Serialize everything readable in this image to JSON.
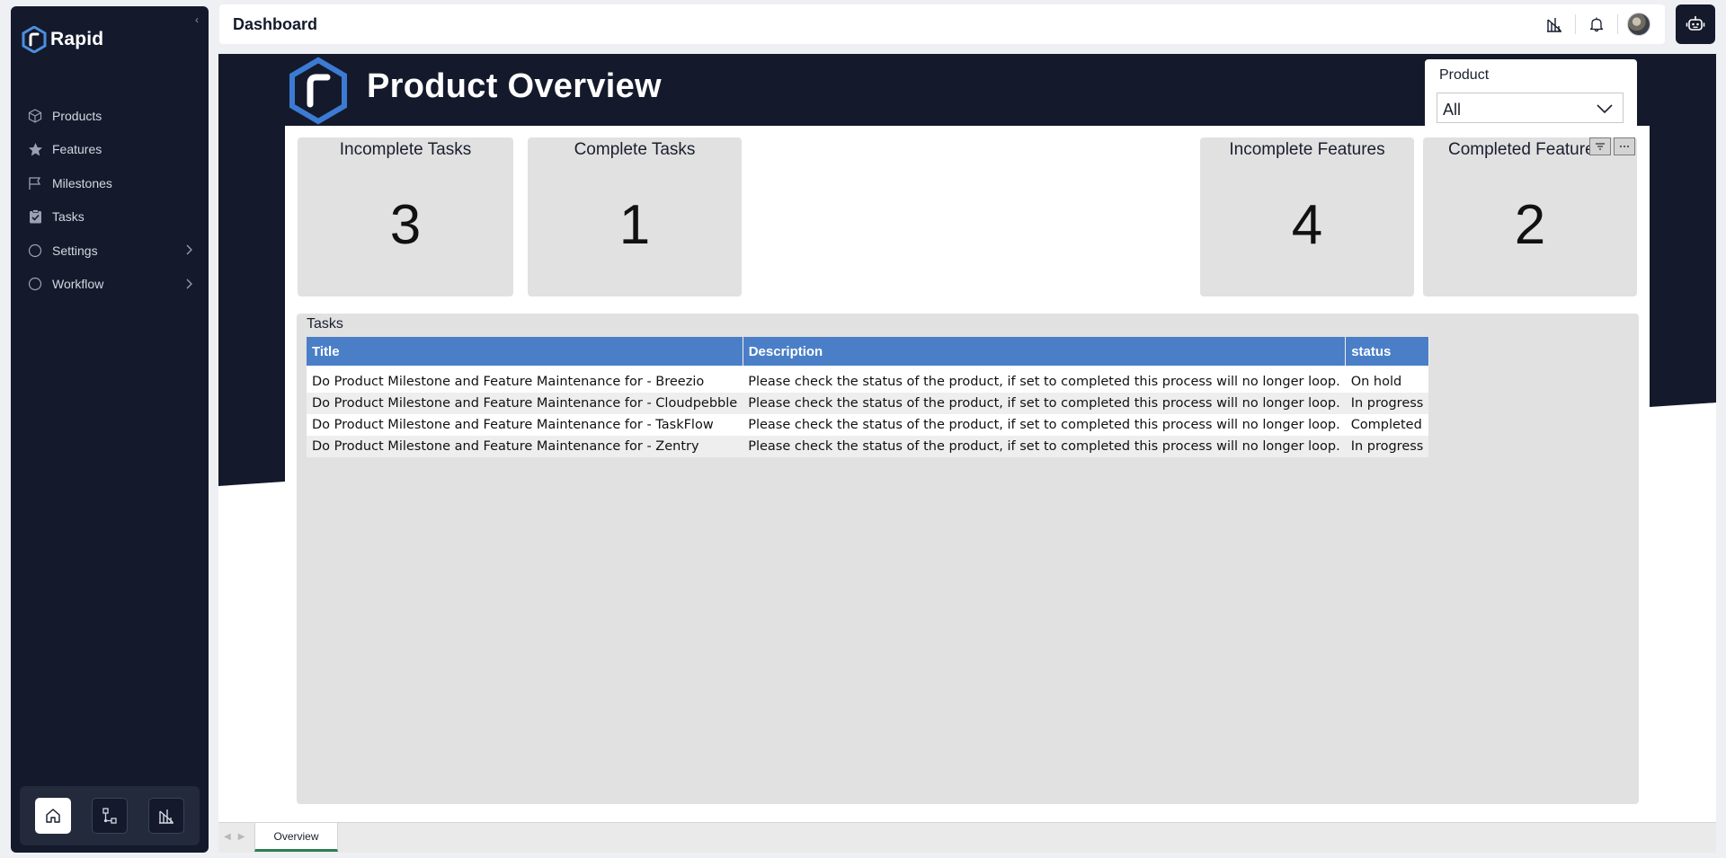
{
  "sidebar": {
    "brand": "Rapid",
    "items": [
      {
        "label": "Products",
        "icon": "box-icon"
      },
      {
        "label": "Features",
        "icon": "star-icon"
      },
      {
        "label": "Milestones",
        "icon": "flag-icon"
      },
      {
        "label": "Tasks",
        "icon": "clipboard-check-icon"
      },
      {
        "label": "Settings",
        "icon": "circle-icon",
        "expandable": true
      },
      {
        "label": "Workflow",
        "icon": "circle-icon",
        "expandable": true
      }
    ],
    "dock": [
      "home-icon",
      "workflow-icon",
      "powerbi-icon"
    ]
  },
  "header": {
    "title": "Dashboard",
    "icons": [
      "powerbi-icon",
      "bell-icon",
      "avatar"
    ]
  },
  "report": {
    "title": "Product Overview",
    "slicer": {
      "label": "Product",
      "value": "All"
    },
    "kpis": [
      {
        "label": "Incomplete Tasks",
        "value": "3"
      },
      {
        "label": "Complete Tasks",
        "value": "1"
      },
      {
        "label": "Incomplete Features",
        "value": "4"
      },
      {
        "label": "Completed Features",
        "value": "2"
      }
    ],
    "table": {
      "title": "Tasks",
      "columns": [
        "Title",
        "Description",
        "status"
      ],
      "rows": [
        [
          "Do Product Milestone and Feature Maintenance for - Breezio",
          "Please check the status of the product, if set to completed this process will no longer loop.",
          "On hold"
        ],
        [
          "Do Product Milestone and Feature Maintenance for - Cloudpebble",
          "Please check the status of the product, if set to completed this process will no longer loop.",
          "In progress"
        ],
        [
          "Do Product Milestone and Feature Maintenance for - TaskFlow",
          "Please check the status of the product, if set to completed this process will no longer loop.",
          "Completed"
        ],
        [
          "Do Product Milestone and Feature Maintenance for - Zentry",
          "Please check the status of the product, if set to completed this process will no longer loop.",
          "In progress"
        ]
      ]
    },
    "tabs": [
      "Overview"
    ]
  },
  "colors": {
    "sidebar_bg": "#141a2b",
    "accent_blue": "#4a7fc8",
    "tab_underline": "#2e7d4f"
  }
}
